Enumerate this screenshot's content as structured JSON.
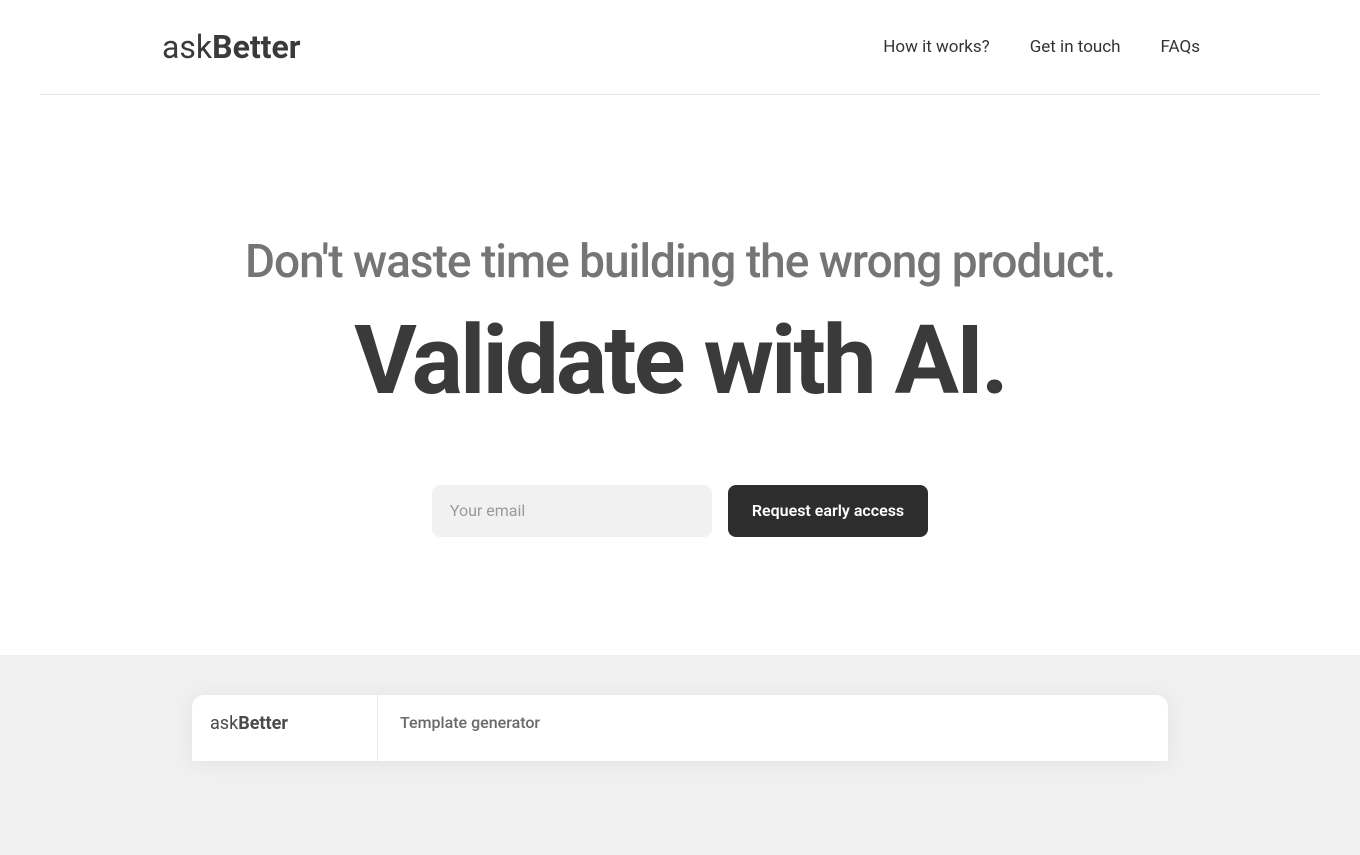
{
  "header": {
    "logo_prefix": "ask",
    "logo_suffix": "Better",
    "nav": [
      {
        "label": "How it works?"
      },
      {
        "label": "Get in touch"
      },
      {
        "label": "FAQs"
      }
    ]
  },
  "hero": {
    "subtitle": "Don't waste time building the wrong product.",
    "title": "Validate with AI."
  },
  "cta": {
    "email_placeholder": "Your email",
    "button_label": "Request early access"
  },
  "preview": {
    "logo_prefix": "ask",
    "logo_suffix": "Better",
    "main_title": "Template generator"
  }
}
